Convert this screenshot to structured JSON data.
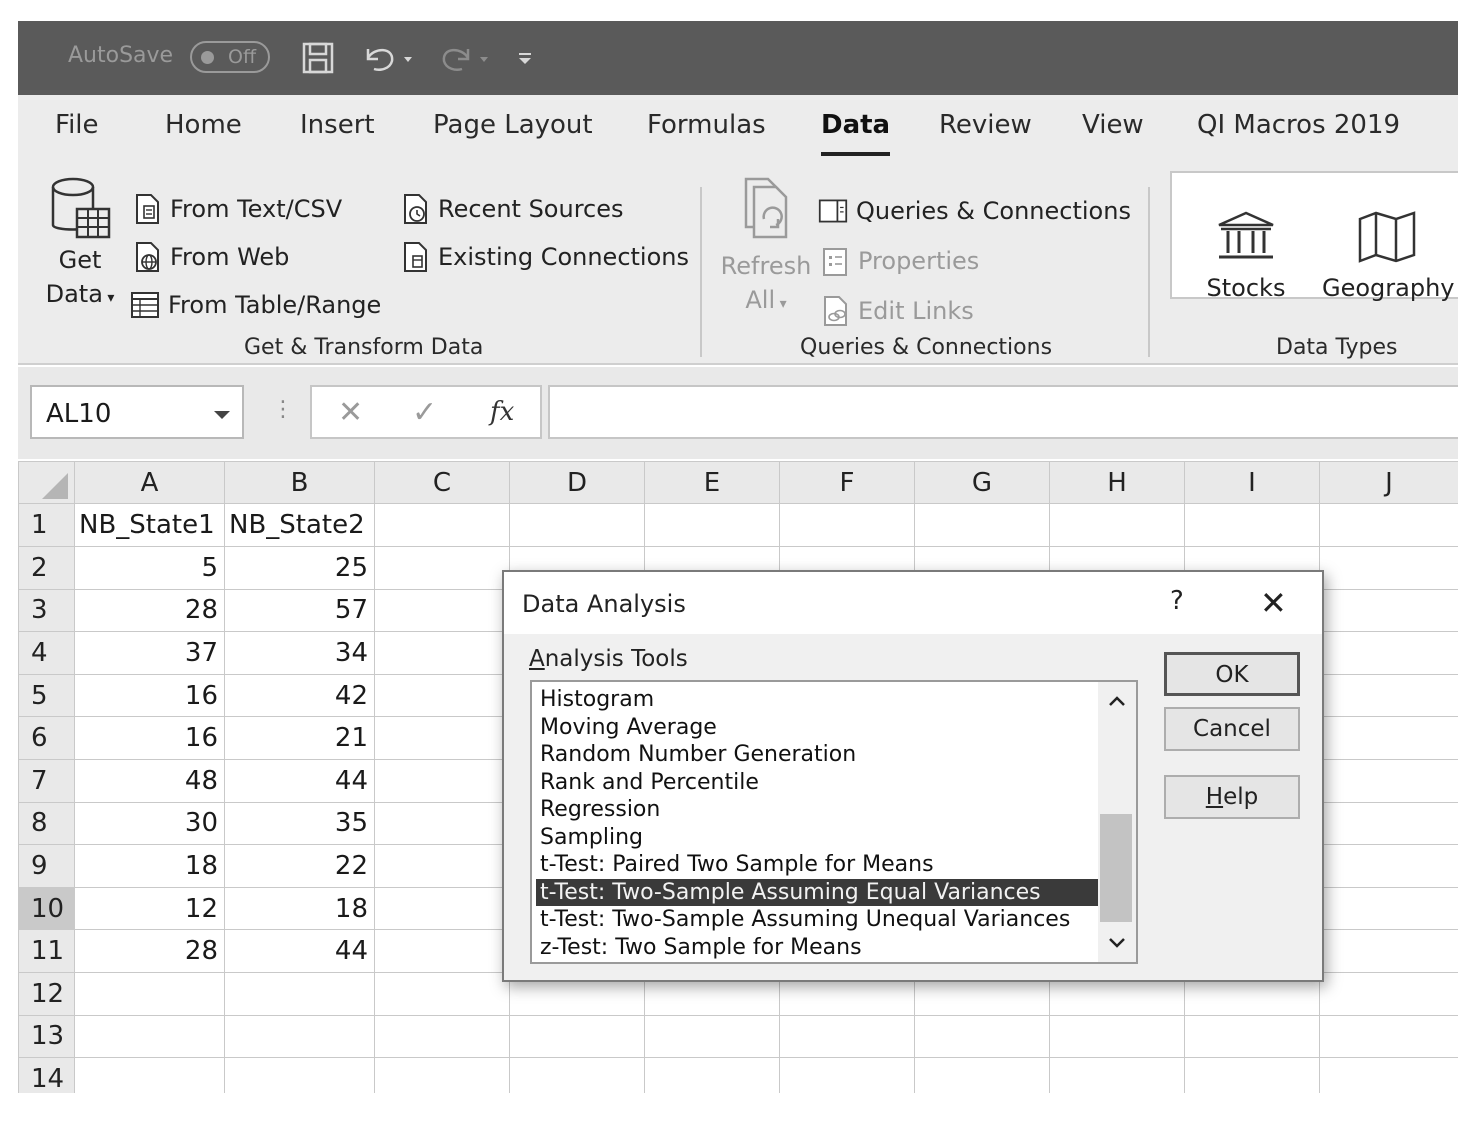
{
  "titlebar": {
    "autosave_label": "AutoSave",
    "autosave_state": "Off",
    "icons": [
      "save-icon",
      "undo-icon",
      "redo-icon",
      "customize-qat-icon"
    ]
  },
  "ribbon_tabs": [
    "File",
    "Home",
    "Insert",
    "Page Layout",
    "Formulas",
    "Data",
    "Review",
    "View",
    "QI Macros 2019"
  ],
  "active_tab": "Data",
  "get_transform": {
    "get_data_line1": "Get",
    "get_data_line2": "Data",
    "from_text_csv": "From Text/CSV",
    "from_web": "From Web",
    "from_table_range": "From Table/Range",
    "recent_sources": "Recent Sources",
    "existing_connections": "Existing Connections",
    "group_label": "Get & Transform Data"
  },
  "queries": {
    "refresh_line1": "Refresh",
    "refresh_line2": "All",
    "queries_connections": "Queries & Connections",
    "properties": "Properties",
    "edit_links": "Edit Links",
    "group_label": "Queries & Connections"
  },
  "data_types": {
    "stocks": "Stocks",
    "geography": "Geography",
    "group_label": "Data Types"
  },
  "formula_bar": {
    "name_box": "AL10",
    "dots": "⋮",
    "cancel_glyph": "✕",
    "enter_glyph": "✓",
    "fx_glyph": "fx",
    "formula": ""
  },
  "sheet": {
    "columns": [
      "A",
      "B",
      "C",
      "D",
      "E",
      "F",
      "G",
      "H",
      "I",
      "J"
    ],
    "rows": [
      {
        "n": "1",
        "a": "NB_State1",
        "b": "NB_State2"
      },
      {
        "n": "2",
        "a": "5",
        "b": "25"
      },
      {
        "n": "3",
        "a": "28",
        "b": "57"
      },
      {
        "n": "4",
        "a": "37",
        "b": "34"
      },
      {
        "n": "5",
        "a": "16",
        "b": "42"
      },
      {
        "n": "6",
        "a": "16",
        "b": "21"
      },
      {
        "n": "7",
        "a": "48",
        "b": "44"
      },
      {
        "n": "8",
        "a": "30",
        "b": "35"
      },
      {
        "n": "9",
        "a": "18",
        "b": "22"
      },
      {
        "n": "10",
        "a": "12",
        "b": "18"
      },
      {
        "n": "11",
        "a": "28",
        "b": "44"
      },
      {
        "n": "12",
        "a": "",
        "b": ""
      },
      {
        "n": "13",
        "a": "",
        "b": ""
      },
      {
        "n": "14",
        "a": "",
        "b": ""
      }
    ],
    "selected_row": "10"
  },
  "dialog": {
    "title": "Data Analysis",
    "help_glyph": "?",
    "close_glyph": "✕",
    "label_underlined": "A",
    "label_rest": "nalysis Tools",
    "tools": [
      "Histogram",
      "Moving Average",
      "Random Number Generation",
      "Rank and Percentile",
      "Regression",
      "Sampling",
      "t-Test: Paired Two Sample for Means",
      "t-Test: Two-Sample Assuming Equal Variances",
      "t-Test: Two-Sample Assuming Unequal Variances",
      "z-Test: Two Sample for Means"
    ],
    "selected_tool": "t-Test: Two-Sample Assuming Equal Variances",
    "ok": "OK",
    "cancel": "Cancel",
    "help_underlined": "H",
    "help_rest": "elp"
  }
}
